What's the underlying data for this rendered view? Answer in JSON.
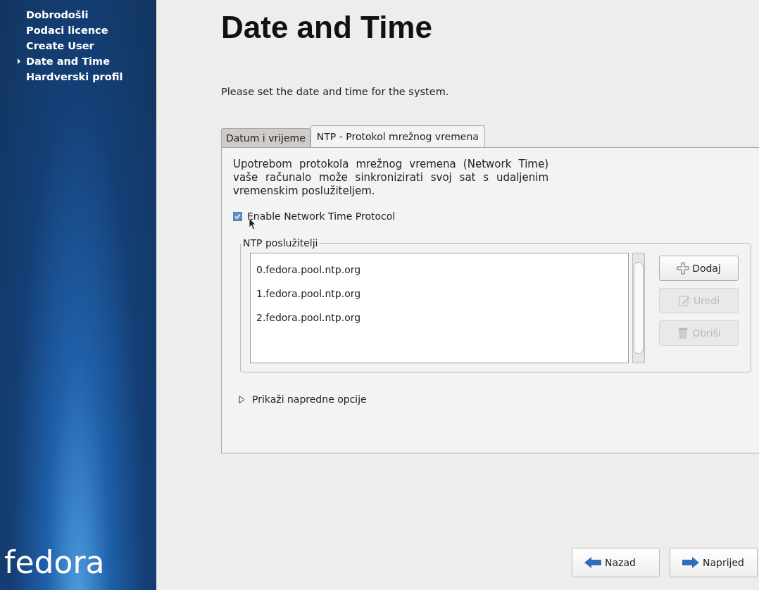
{
  "sidebar": {
    "items": [
      {
        "label": "Dobrodošli",
        "selected": false
      },
      {
        "label": "Podaci licence",
        "selected": false
      },
      {
        "label": "Create User",
        "selected": false
      },
      {
        "label": "Date and Time",
        "selected": true
      },
      {
        "label": "Hardverski profil",
        "selected": false
      }
    ],
    "logo": "fedora"
  },
  "page": {
    "title": "Date and Time",
    "subtitle": "Please set the date and time for the system."
  },
  "tabs": [
    {
      "label": "Datum i vrijeme",
      "selected": false
    },
    {
      "label": "NTP - Protokol mrežnog vremena",
      "selected": true
    }
  ],
  "ntp": {
    "description": "Upotrebom protokola mrežnog vremena (Network Time) vaše računalo može sinkronizirati svoj sat s udaljenim vremenskim poslužiteljem.",
    "enable": {
      "label": "Enable Network Time Protocol",
      "checked": true
    },
    "servers_group": "NTP poslužitelji",
    "servers": [
      "0.fedora.pool.ntp.org",
      "1.fedora.pool.ntp.org",
      "2.fedora.pool.ntp.org"
    ],
    "buttons": [
      {
        "kind": "add",
        "label": "Dodaj",
        "disabled": false
      },
      {
        "kind": "edit",
        "label": "Uredi",
        "disabled": true
      },
      {
        "kind": "delete",
        "label": "Obriši",
        "disabled": true
      }
    ],
    "advanced": {
      "label": "Prikaži napredne opcije",
      "expanded": false
    }
  },
  "footer": {
    "buttons": [
      {
        "kind": "back",
        "label": "Nazad"
      },
      {
        "kind": "forward",
        "label": "Naprijed"
      }
    ]
  }
}
